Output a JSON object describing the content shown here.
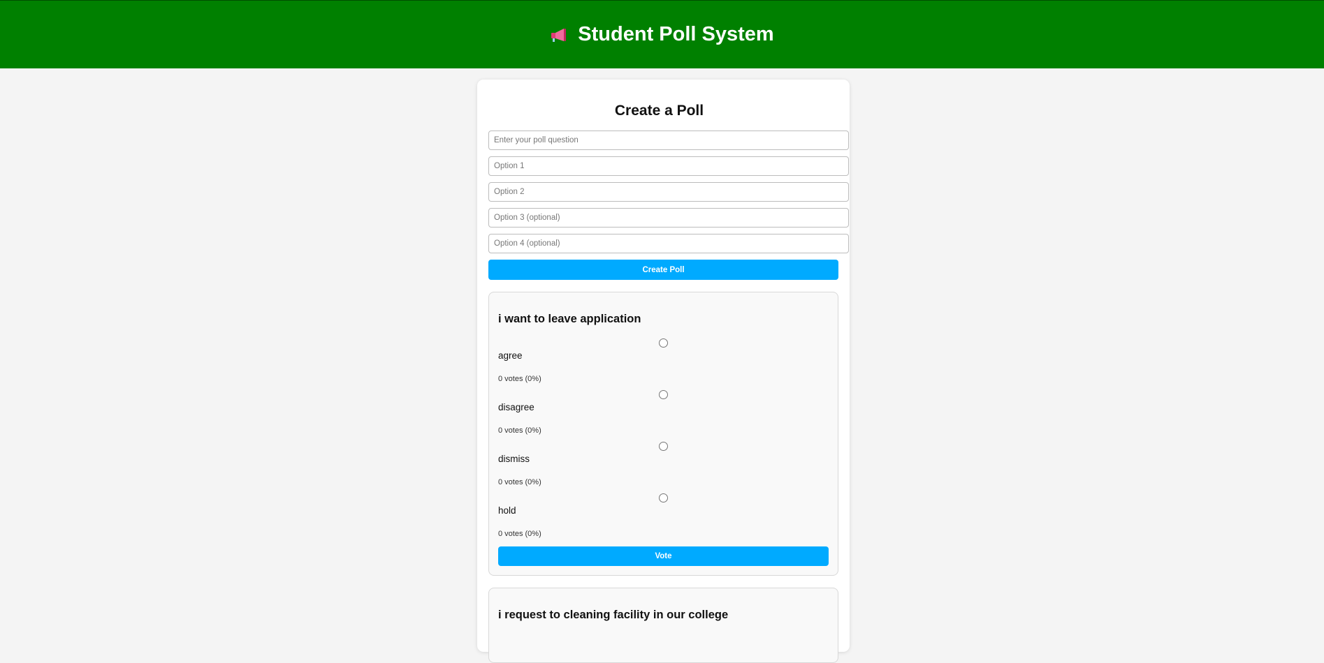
{
  "header": {
    "icon": "megaphone-icon",
    "title": "Student Poll System",
    "background": "#008000"
  },
  "create": {
    "heading": "Create a Poll",
    "question_placeholder": "Enter your poll question",
    "option1_placeholder": "Option 1",
    "option2_placeholder": "Option 2",
    "option3_placeholder": "Option 3 (optional)",
    "option4_placeholder": "Option 4 (optional)",
    "button_label": "Create Poll",
    "button_color": "#00aaff"
  },
  "polls": [
    {
      "question": "i want to leave application",
      "options": [
        {
          "label": "agree",
          "votes": "0 votes (0%)"
        },
        {
          "label": "disagree",
          "votes": "0 votes (0%)"
        },
        {
          "label": "dismiss",
          "votes": "0 votes (0%)"
        },
        {
          "label": "hold",
          "votes": "0 votes (0%)"
        }
      ],
      "vote_label": "Vote"
    },
    {
      "question": "i request to cleaning facility in our college"
    }
  ]
}
